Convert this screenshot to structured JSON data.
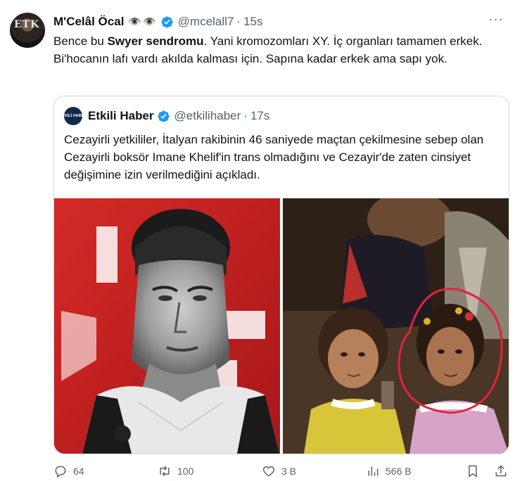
{
  "tweet": {
    "author_name": "M'Celâl Öcal",
    "author_emoji": "👁️👁️",
    "author_handle": "@mcelall7",
    "separator": "·",
    "time": "15s",
    "more_label": "···",
    "text_part1": "Bence bu ",
    "text_bold": "Swyer sendromu",
    "text_part2": ". Yani kromozomları XY. İç organları tamamen erkek. Bi'hocanın lafı vardı akılda kalması için. Sapına kadar erkek ama sapı yok.",
    "avatar_text": "ETK"
  },
  "quote": {
    "avatar_text": "ETKİLİ HABER",
    "author_name": "Etkili Haber",
    "author_handle": "@etkilihaber",
    "separator": "·",
    "time": "17s",
    "text": "Cezayirli yetkililer, İtalyan rakibinin 46 saniyede maçtan çekilmesine sebep olan Cezayirli boksör Imane Khelif'in trans olmadığını ve Cezayir'de zaten cinsiyet değişimine izin verilmediğini açıkladı."
  },
  "actions": {
    "replies": "64",
    "retweets": "100",
    "likes": "3 B",
    "views": "566 B"
  },
  "colors": {
    "verified": "#1d9bf0",
    "muted": "#536471",
    "border": "#cfd9de",
    "red_bg": "#c5201f"
  }
}
